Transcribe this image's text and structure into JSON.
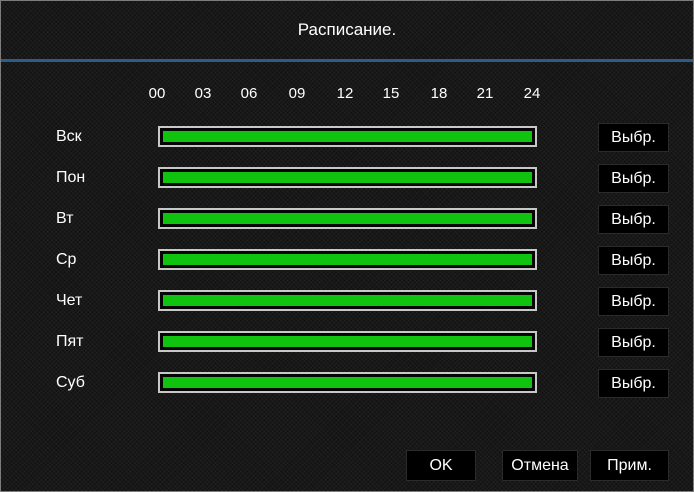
{
  "dialog": {
    "title": "Расписание."
  },
  "schedule": {
    "hour_labels": [
      "00",
      "03",
      "06",
      "09",
      "12",
      "15",
      "18",
      "21",
      "24"
    ],
    "bar_color": "#0fc30f",
    "days": [
      {
        "label": "Вск",
        "select_label": "Выбр.",
        "recorded_fraction": 1.0
      },
      {
        "label": "Пон",
        "select_label": "Выбр.",
        "recorded_fraction": 1.0
      },
      {
        "label": "Вт",
        "select_label": "Выбр.",
        "recorded_fraction": 1.0
      },
      {
        "label": "Ср",
        "select_label": "Выбр.",
        "recorded_fraction": 1.0
      },
      {
        "label": "Чет",
        "select_label": "Выбр.",
        "recorded_fraction": 1.0
      },
      {
        "label": "Пят",
        "select_label": "Выбр.",
        "recorded_fraction": 1.0
      },
      {
        "label": "Суб",
        "select_label": "Выбр.",
        "recorded_fraction": 1.0
      }
    ]
  },
  "footer": {
    "ok_label": "OK",
    "cancel_label": "Отмена",
    "apply_label": "Прим."
  }
}
